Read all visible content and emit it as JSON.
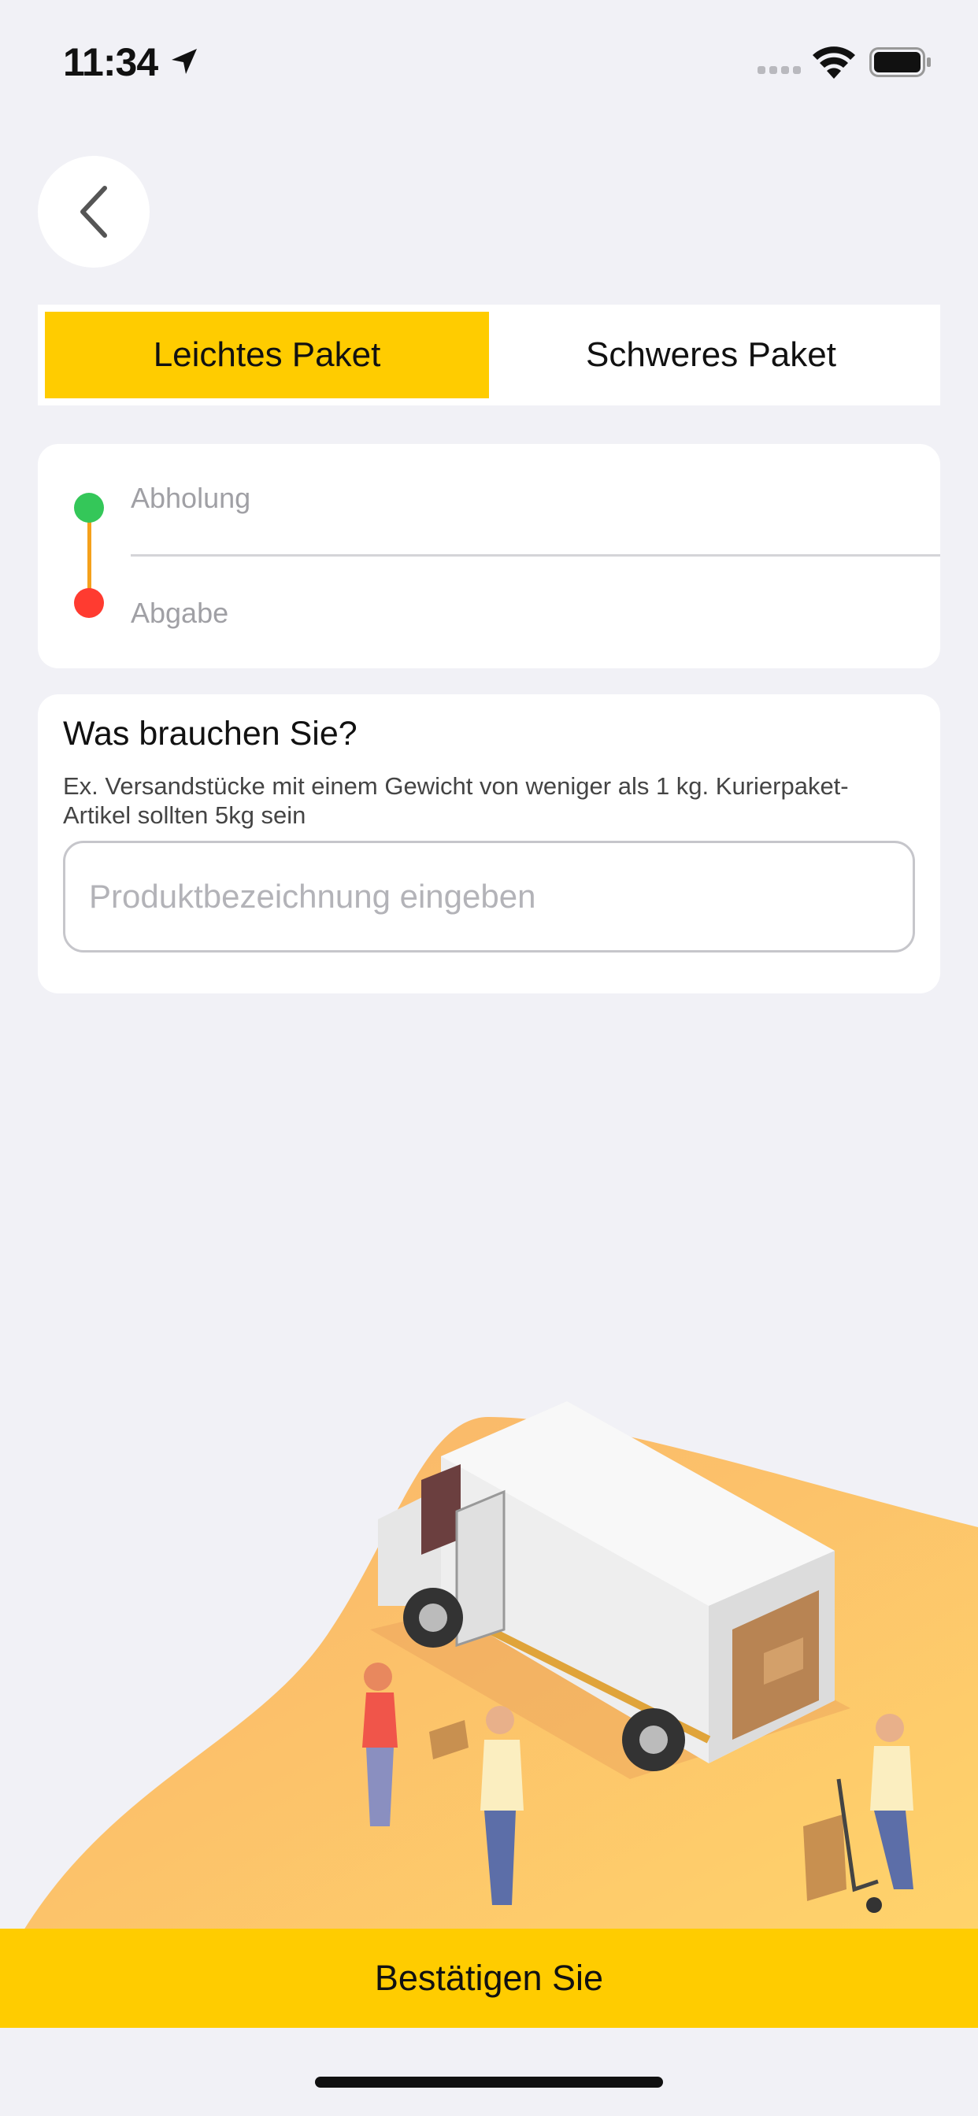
{
  "status_bar": {
    "time": "11:34",
    "location_icon": "location-arrow-icon",
    "signal_icon": "cellular-signal-icon",
    "wifi_icon": "wifi-icon",
    "battery_icon": "battery-icon"
  },
  "nav": {
    "back_icon": "chevron-left-icon"
  },
  "tabs": [
    {
      "label": "Leichtes Paket",
      "active": true
    },
    {
      "label": "Schweres Paket",
      "active": false
    }
  ],
  "route": {
    "pickup_label": "Abholung",
    "dropoff_label": "Abgabe",
    "pickup_color": "#34c759",
    "dropoff_color": "#ff3b30",
    "line_color": "#f5a11c"
  },
  "need": {
    "title": "Was brauchen Sie?",
    "hint": "Ex. Versandstücke mit einem Gewicht von weniger als 1 kg. Kurierpaket-Artikel sollten 5kg sein",
    "input_placeholder": "Produktbezeichnung eingeben",
    "input_value": ""
  },
  "illustration": {
    "icon": "delivery-van-illustration"
  },
  "confirm": {
    "label": "Bestätigen Sie"
  },
  "colors": {
    "accent": "#ffcc00",
    "background": "#f1f1f6"
  }
}
